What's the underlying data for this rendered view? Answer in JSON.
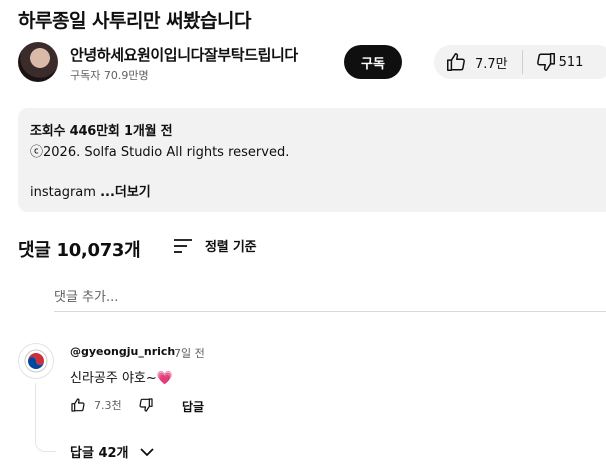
{
  "video": {
    "title": "하루종일 사투리만 써봤습니다"
  },
  "channel": {
    "name": "안녕하세요원이입니다잘부탁드립니다",
    "subscribers": "구독자 70.9만명",
    "subscribe_label": "구독"
  },
  "actions": {
    "like_count": "7.7만",
    "dislike_count": "511"
  },
  "description": {
    "views_and_date": "조회수 446만회  1개월 전",
    "copyright": "ⓒ2026. Solfa Studio All rights reserved.",
    "preview_text": "instagram",
    "more_label": "...더보기"
  },
  "comments": {
    "count_label": "댓글 10,073개",
    "sort_label": "정렬 기준",
    "add_placeholder": "댓글 추가...",
    "items": [
      {
        "author": "@gyeongju_nrich",
        "time": "7일 전",
        "text": "신라공주 야호~💗",
        "like_count": "7.3천",
        "reply_label": "답글",
        "replies_label": "답글 42개"
      }
    ]
  }
}
